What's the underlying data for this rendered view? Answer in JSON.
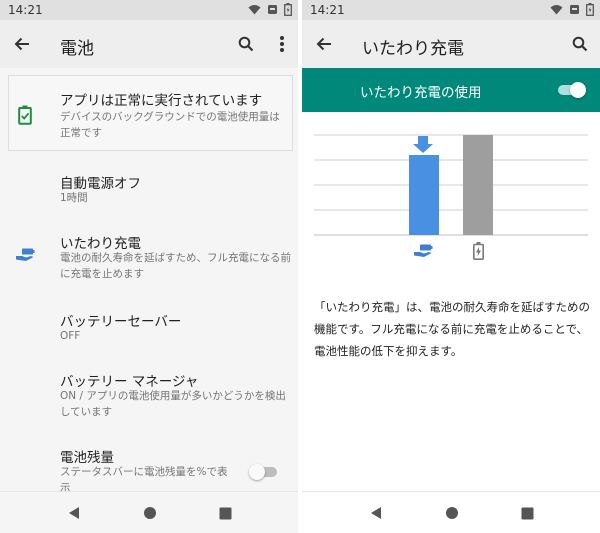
{
  "left": {
    "status_time": "14:21",
    "title": "電池",
    "icons": {
      "back": "arrow-back-icon",
      "search": "search-icon",
      "more": "more-vert-icon"
    },
    "card": {
      "title": "アプリは正常に実行されています",
      "subtitle": "デバイスのバックグラウンドでの電池使用量は正常です",
      "icon": "battery-check-icon",
      "icon_color": "#1e8e3e"
    },
    "items": [
      {
        "title": "自動電源オフ",
        "subtitle": "1時間"
      },
      {
        "title": "いたわり充電",
        "subtitle": "電池の耐久寿命を延ばすため、フル充電になる前に充電を止めます",
        "icon": "battery-care-icon"
      },
      {
        "title": "バッテリーセーバー",
        "subtitle": "OFF"
      },
      {
        "title": "バッテリー マネージャ",
        "subtitle": "ON / アプリの電池使用量が多いかどうかを検出しています"
      },
      {
        "title": "電池残量",
        "subtitle": "ステータスバーに電池残量を%で表示",
        "toggle_on": false
      }
    ]
  },
  "right": {
    "status_time": "14:21",
    "title": "いたわり充電",
    "icons": {
      "back": "arrow-back-icon",
      "search": "search-icon"
    },
    "banner": {
      "label": "いたわり充電の使用",
      "toggle_on": true,
      "color": "#00897b"
    },
    "chart_data": {
      "type": "bar",
      "categories": [
        "いたわり充電",
        "通常充電"
      ],
      "values": [
        80,
        100
      ],
      "ylim": [
        0,
        100
      ],
      "colors": [
        "#4a90e2",
        "#9e9e9e"
      ],
      "grid": true
    },
    "description": "「いたわり充電」は、電池の耐久寿命を延ばすための機能です。フル充電になる前に充電を止めることで、電池性能の低下を抑えます。"
  },
  "nav_icons": [
    "back-triangle-icon",
    "home-circle-icon",
    "recents-square-icon"
  ]
}
